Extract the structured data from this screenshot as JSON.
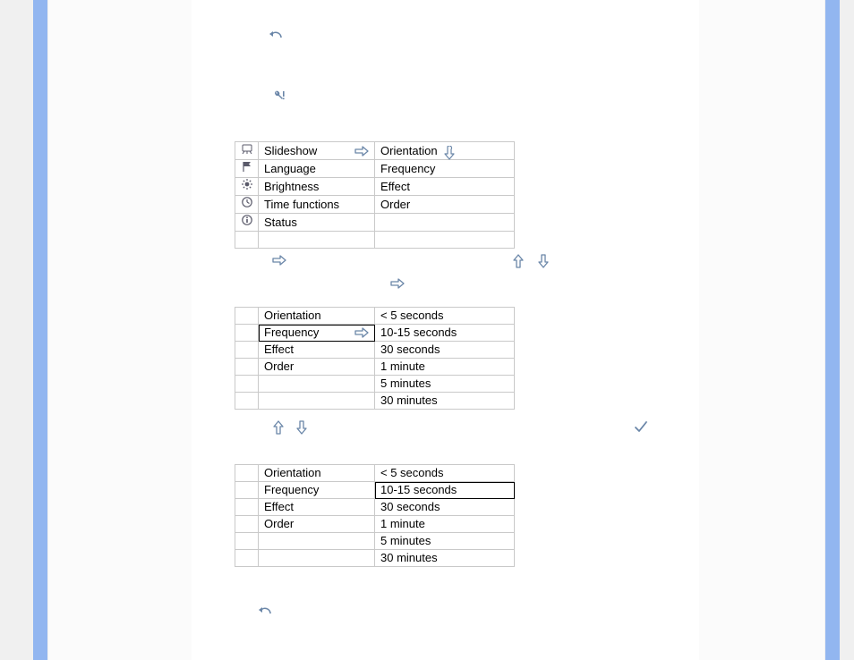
{
  "icons": {
    "undo": "undo-icon",
    "wrench": "wrench-exclaim-icon",
    "arrow_right": "arrow-right-icon",
    "arrow_left": "arrow-left-icon",
    "arrow_up": "arrow-up-icon",
    "arrow_down": "arrow-down-icon",
    "point_down": "pointer-down-icon",
    "check": "check-icon",
    "projector": "projector-icon",
    "flag": "flag-icon",
    "brightness": "brightness-icon",
    "clock": "clock-icon",
    "info": "info-icon"
  },
  "table1": {
    "left": [
      {
        "icon": "projector",
        "label": "Slideshow",
        "arrow": true
      },
      {
        "icon": "flag",
        "label": "Language",
        "arrow": false
      },
      {
        "icon": "brightness",
        "label": "Brightness",
        "arrow": false
      },
      {
        "icon": "clock",
        "label": "Time functions",
        "arrow": false
      },
      {
        "icon": "info",
        "label": "Status",
        "arrow": false
      },
      {
        "icon": "",
        "label": "",
        "arrow": false
      }
    ],
    "right": [
      {
        "label": "Orientation",
        "pointer": true
      },
      {
        "label": "Frequency"
      },
      {
        "label": "Effect"
      },
      {
        "label": "Order"
      },
      {
        "label": ""
      },
      {
        "label": ""
      }
    ]
  },
  "table2": {
    "left": [
      {
        "label": "Orientation"
      },
      {
        "label": "Frequency",
        "arrow": true,
        "selected": true
      },
      {
        "label": "Effect"
      },
      {
        "label": "Order"
      },
      {
        "label": ""
      },
      {
        "label": ""
      }
    ],
    "right": [
      {
        "label": "< 5 seconds"
      },
      {
        "label": "10-15 seconds"
      },
      {
        "label": "30 seconds"
      },
      {
        "label": "1 minute"
      },
      {
        "label": "5 minutes"
      },
      {
        "label": "30 minutes"
      }
    ]
  },
  "table3": {
    "left": [
      {
        "label": "Orientation"
      },
      {
        "label": "Frequency"
      },
      {
        "label": "Effect"
      },
      {
        "label": "Order"
      },
      {
        "label": ""
      },
      {
        "label": ""
      }
    ],
    "right": [
      {
        "label": "< 5 seconds"
      },
      {
        "label": "10-15 seconds",
        "selected": true
      },
      {
        "label": "30 seconds"
      },
      {
        "label": "1 minute"
      },
      {
        "label": "5 minutes"
      },
      {
        "label": "30 minutes"
      }
    ]
  }
}
